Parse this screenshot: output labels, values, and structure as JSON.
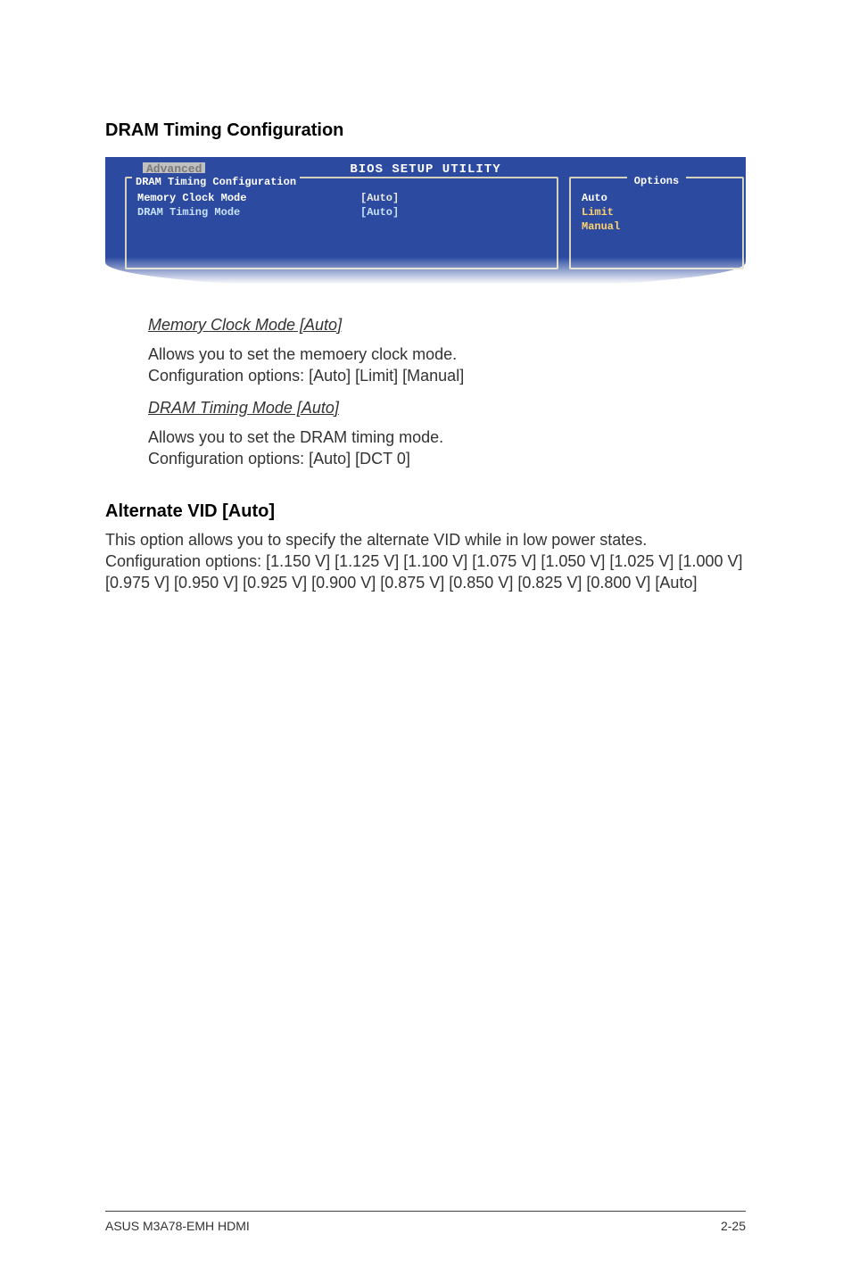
{
  "section": {
    "title": "DRAM Timing Configuration"
  },
  "bios": {
    "utility_title": "BIOS SETUP UTILITY",
    "tab_label": "Advanced",
    "panel_title": "DRAM Timing Configuration",
    "rows": [
      {
        "label": "Memory Clock Mode",
        "value": "[Auto]"
      },
      {
        "label": "DRAM Timing Mode",
        "value": "[Auto]"
      }
    ],
    "options_title": "Options",
    "options": [
      "Auto",
      "Limit",
      "Manual"
    ]
  },
  "entries": [
    {
      "heading": "Memory Clock Mode [Auto]",
      "desc": "Allows you to set the memoery clock mode.\nConfiguration options: [Auto] [Limit] [Manual]"
    },
    {
      "heading": "DRAM Timing Mode [Auto]",
      "desc": "Allows you to set the DRAM timing mode.\nConfiguration options: [Auto] [DCT 0]"
    }
  ],
  "alt_vid": {
    "title": "Alternate VID [Auto]",
    "desc": "This option allows you to specify the alternate VID while in low power states. Configuration options: [1.150 V] [1.125 V] [1.100 V] [1.075 V] [1.050 V] [1.025 V] [1.000 V] [0.975 V] [0.950 V] [0.925 V] [0.900 V] [0.875 V] [0.850 V] [0.825 V] [0.800 V] [Auto]"
  },
  "footer": {
    "left": "ASUS M3A78-EMH HDMI",
    "right": "2-25"
  }
}
